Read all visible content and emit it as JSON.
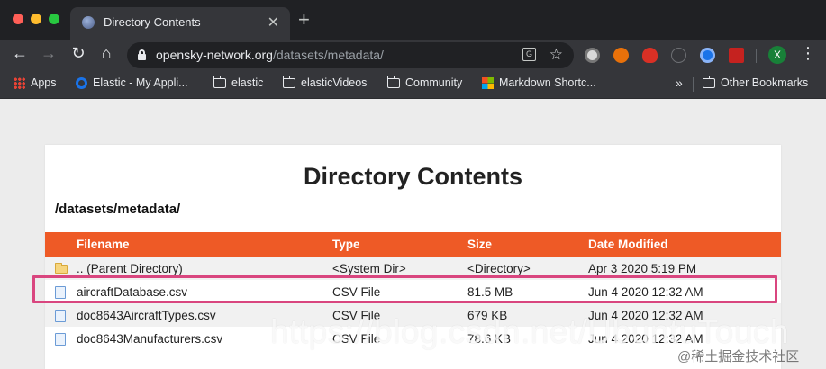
{
  "tab": {
    "title": "Directory Contents",
    "close": "✕",
    "new_tab": "+"
  },
  "toolbar": {
    "back": "←",
    "forward": "→",
    "reload": "↻",
    "home": "⌂",
    "url_host": "opensky-network.org",
    "url_path": "/datasets/metadata/",
    "star": "☆",
    "profile_initial": "X",
    "menu": "⋮"
  },
  "bookmarks": {
    "items": [
      {
        "label": "Apps",
        "icon": "apps-grid-icon"
      },
      {
        "label": "Elastic - My Appli...",
        "icon": "elastic-icon"
      },
      {
        "label": "elastic",
        "icon": "folder-icon"
      },
      {
        "label": "elasticVideos",
        "icon": "folder-icon"
      },
      {
        "label": "Community",
        "icon": "folder-icon"
      },
      {
        "label": "Markdown Shortc...",
        "icon": "microsoft-icon"
      }
    ],
    "overflow": "»",
    "other": "Other Bookmarks"
  },
  "page": {
    "title": "Directory Contents",
    "path": "/datasets/metadata/",
    "columns": [
      "Filename",
      "Type",
      "Size",
      "Date Modified"
    ],
    "rows": [
      {
        "icon": "folder",
        "name": ".. (Parent Directory)",
        "type": "<System Dir>",
        "size": "<Directory>",
        "date": "Apr 3 2020 5:19 PM"
      },
      {
        "icon": "file",
        "name": "aircraftDatabase.csv",
        "type": "CSV File",
        "size": "81.5 MB",
        "date": "Jun 4 2020 12:32 AM"
      },
      {
        "icon": "file",
        "name": "doc8643AircraftTypes.csv",
        "type": "CSV File",
        "size": "679 KB",
        "date": "Jun 4 2020 12:32 AM"
      },
      {
        "icon": "file",
        "name": "doc8643Manufacturers.csv",
        "type": "CSV File",
        "size": "78.6 KB",
        "date": "Jun 4 2020 12:32 AM"
      }
    ],
    "highlighted_row": 1
  },
  "overlay": {
    "watermark": "https://blog.csdn.net/UbuntuTouch",
    "credit": "@稀土掘金技术社区"
  },
  "colors": {
    "header": "#ee5a26",
    "highlight": "#d9467f",
    "chrome_dark": "#202124",
    "chrome": "#35363a"
  }
}
